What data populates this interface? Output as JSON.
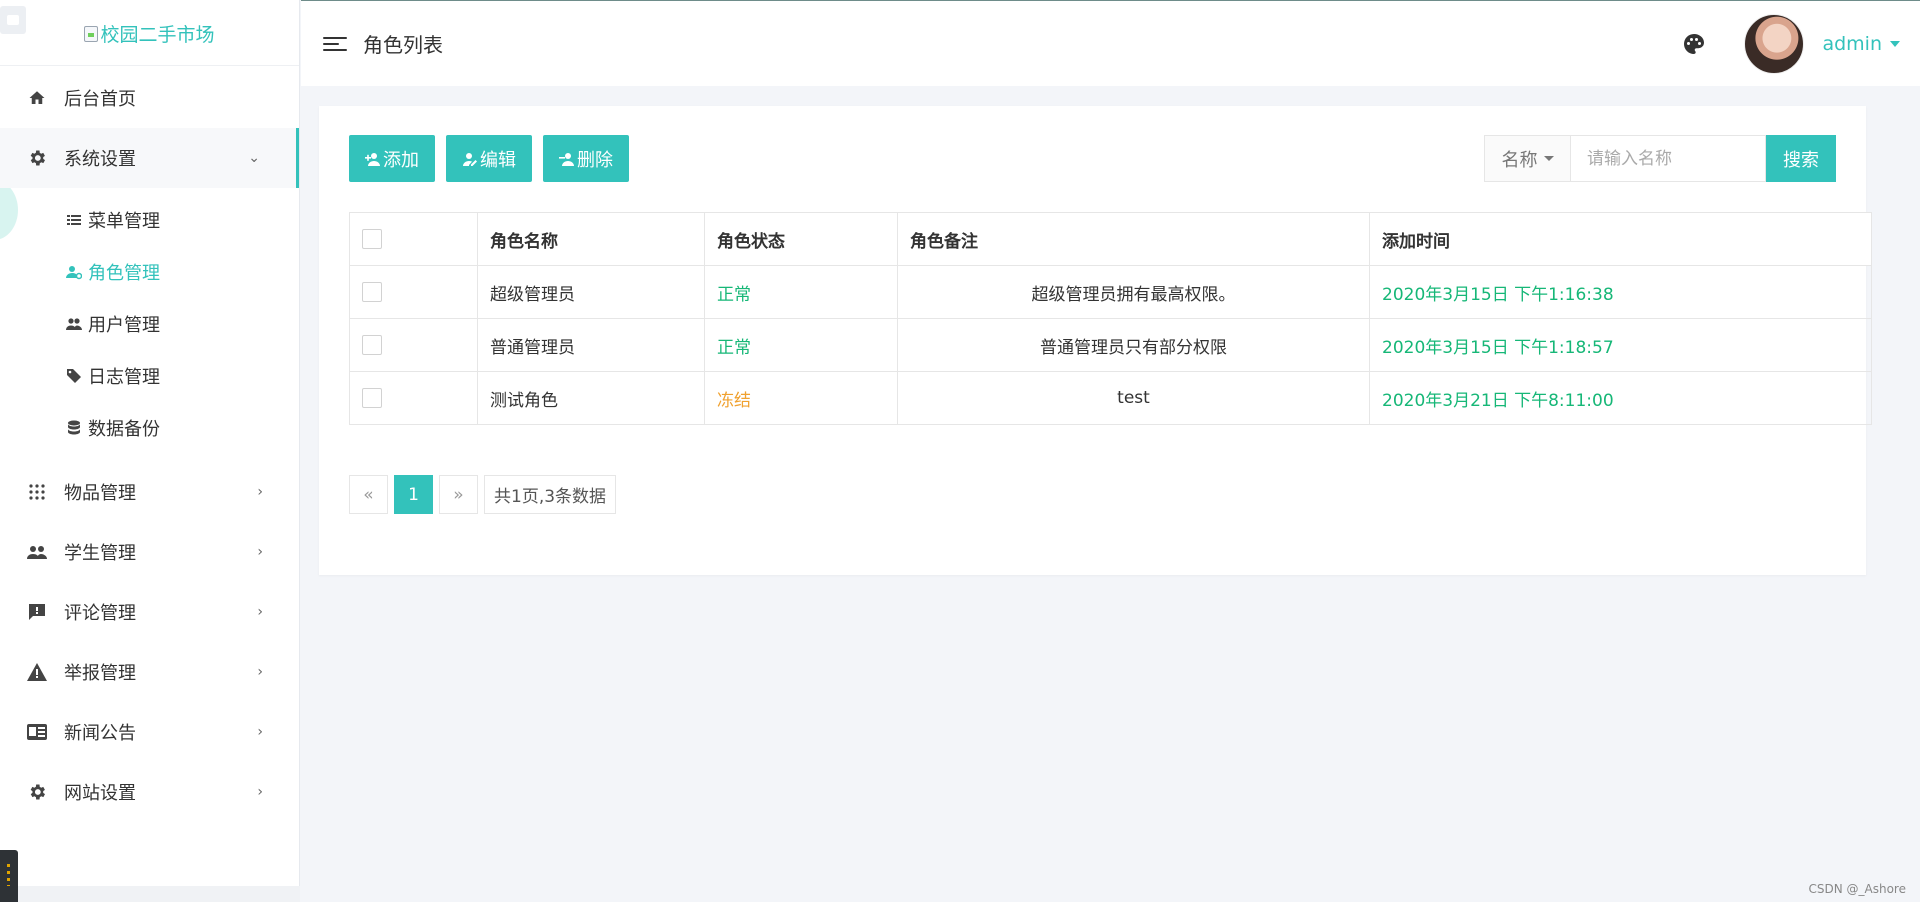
{
  "sidebar": {
    "logo_alt": "校园二手市场",
    "items": [
      {
        "label": "后台首页"
      },
      {
        "label": "系统设置"
      },
      {
        "label": "物品管理"
      },
      {
        "label": "学生管理"
      },
      {
        "label": "评论管理"
      },
      {
        "label": "举报管理"
      },
      {
        "label": "新闻公告"
      },
      {
        "label": "网站设置"
      }
    ],
    "submenu": [
      {
        "label": "菜单管理"
      },
      {
        "label": "角色管理"
      },
      {
        "label": "用户管理"
      },
      {
        "label": "日志管理"
      },
      {
        "label": "数据备份"
      }
    ]
  },
  "header": {
    "title": "角色列表",
    "user": "admin"
  },
  "toolbar": {
    "add": "添加",
    "edit": "编辑",
    "delete": "删除"
  },
  "search": {
    "field": "名称",
    "placeholder": "请输入名称",
    "button": "搜索"
  },
  "table": {
    "columns": [
      "角色名称",
      "角色状态",
      "角色备注",
      "添加时间"
    ],
    "rows": [
      {
        "name": "超级管理员",
        "status": "正常",
        "remark": "超级管理员拥有最高权限。",
        "time": "2020年3月15日 下午1:16:38"
      },
      {
        "name": "普通管理员",
        "status": "正常",
        "remark": "普通管理员只有部分权限",
        "time": "2020年3月15日 下午1:18:57"
      },
      {
        "name": "测试角色",
        "status": "冻结",
        "remark": "test",
        "time": "2020年3月21日 下午8:11:00"
      }
    ]
  },
  "pagination": {
    "prev": "«",
    "current": "1",
    "next": "»",
    "info": "共1页,3条数据"
  },
  "watermark": "CSDN @_Ashore",
  "colors": {
    "accent": "#33c2bb",
    "status_normal": "#16b777",
    "status_frozen": "#f0a12f"
  },
  "icons": {
    "menu": [
      "home-icon",
      "gear-icon",
      "grid-icon",
      "people-icon",
      "comment-icon",
      "warning-icon",
      "news-icon",
      "gear-icon"
    ],
    "submenu": [
      "list-icon",
      "user-role-icon",
      "users-icon",
      "tags-icon",
      "database-icon"
    ]
  }
}
